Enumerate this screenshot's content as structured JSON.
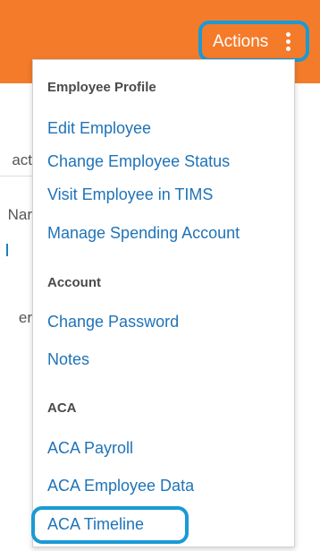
{
  "header": {
    "actions_label": "Actions",
    "actions_icon": "kebab-vertical-icon",
    "bar_color": "#f47b2a",
    "highlight_color": "#1a9ad6"
  },
  "background": {
    "fragments": [
      "act",
      "Nar",
      "er"
    ]
  },
  "menu": {
    "sections": [
      {
        "header": "Employee Profile",
        "items": [
          "Edit Employee",
          "Change Employee Status",
          "Visit Employee in TIMS",
          "Manage Spending Account"
        ]
      },
      {
        "header": "Account",
        "items": [
          "Change Password",
          "Notes"
        ]
      },
      {
        "header": "ACA",
        "items": [
          "ACA Payroll",
          "ACA Employee Data",
          "ACA Timeline"
        ]
      }
    ],
    "link_color": "#1f73b8"
  }
}
